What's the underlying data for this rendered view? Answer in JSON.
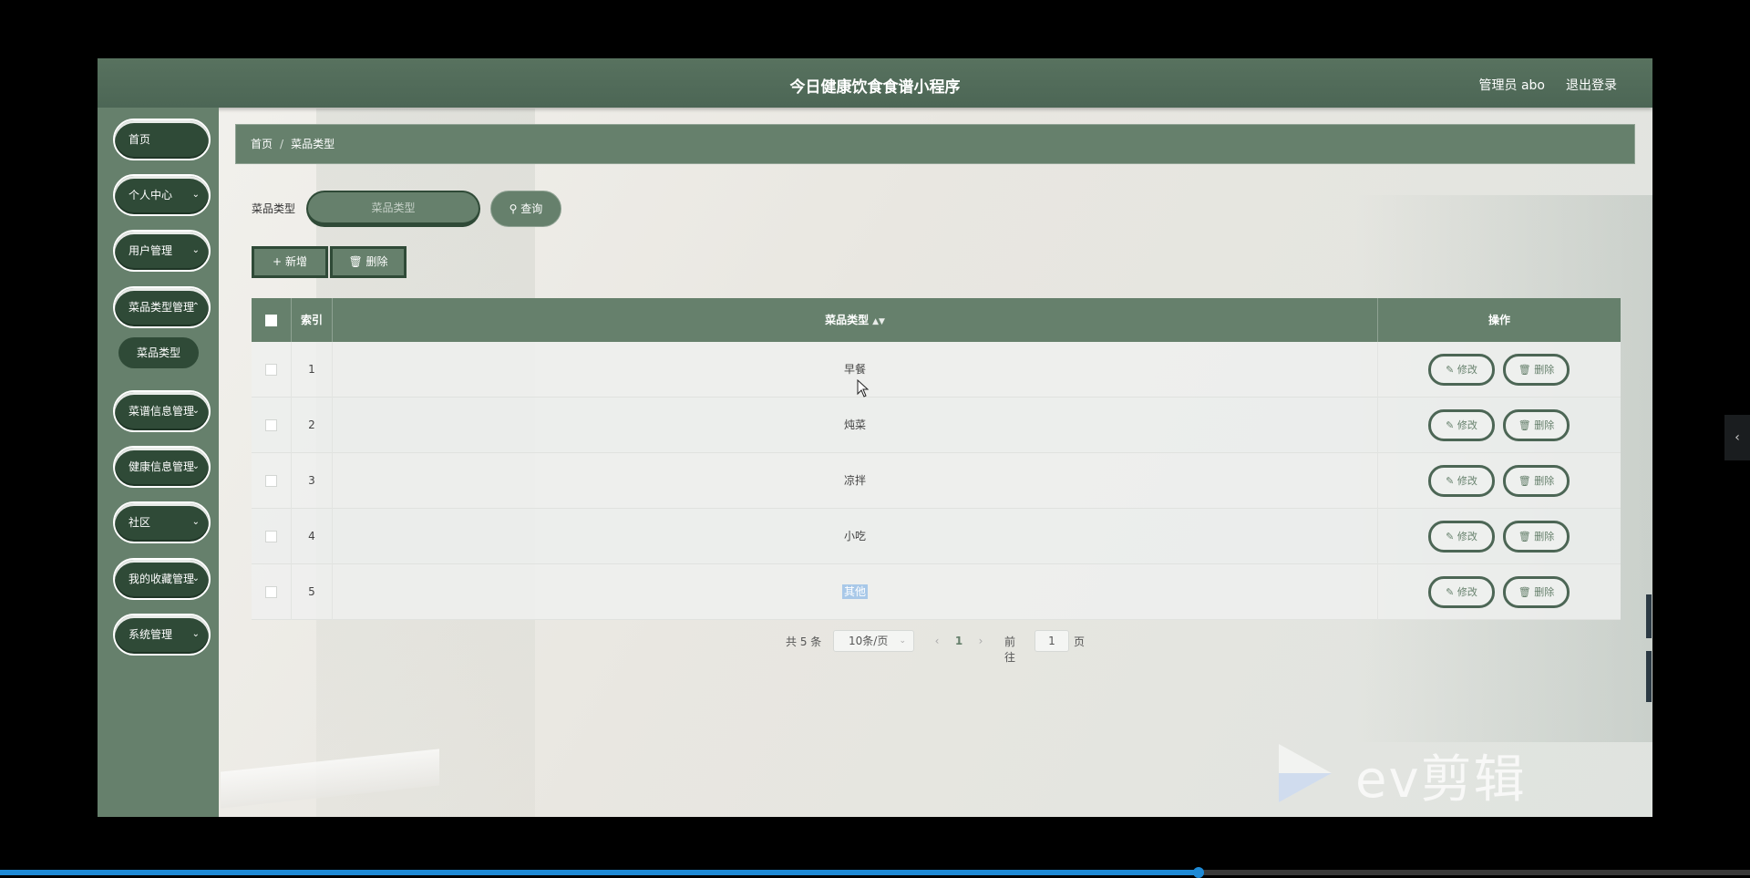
{
  "header": {
    "title": "今日健康饮食食谱小程序",
    "user_label": "管理员 abo",
    "logout_label": "退出登录"
  },
  "sidebar": {
    "items": [
      {
        "label": "首页",
        "has_arrow": false
      },
      {
        "label": "个人中心",
        "has_arrow": true
      },
      {
        "label": "用户管理",
        "has_arrow": true
      },
      {
        "label": "菜品类型管理",
        "has_arrow": true
      },
      {
        "label": "菜谱信息管理",
        "has_arrow": true
      },
      {
        "label": "健康信息管理",
        "has_arrow": true
      },
      {
        "label": "社区",
        "has_arrow": true
      },
      {
        "label": "我的收藏管理",
        "has_arrow": true
      },
      {
        "label": "系统管理",
        "has_arrow": true
      }
    ],
    "active_subitem": "菜品类型"
  },
  "breadcrumb": {
    "home": "首页",
    "separator": "/",
    "current": "菜品类型"
  },
  "search": {
    "label": "菜品类型",
    "placeholder": "菜品类型",
    "button_label": "查询"
  },
  "actions": {
    "add_label": "新增",
    "delete_label": "删除"
  },
  "table": {
    "headers": {
      "index": "索引",
      "type": "菜品类型",
      "ops": "操作"
    },
    "rows": [
      {
        "index": "1",
        "type": "早餐"
      },
      {
        "index": "2",
        "type": "炖菜"
      },
      {
        "index": "3",
        "type": "凉拌"
      },
      {
        "index": "4",
        "type": "小吃"
      },
      {
        "index": "5",
        "type": "其他"
      }
    ],
    "edit_label": "修改",
    "delete_label": "删除"
  },
  "pagination": {
    "total": "共 5 条",
    "page_size": "10条/页",
    "current_page": "1",
    "goto_label": "前往",
    "goto_value": "1",
    "goto_suffix": "页"
  },
  "watermark": {
    "text": "ev剪辑"
  },
  "video_progress": 0.685,
  "colors": {
    "primary": "#66806c",
    "dark": "#2f4a37",
    "header": "#4c6655",
    "progress": "#1e8ad6"
  }
}
